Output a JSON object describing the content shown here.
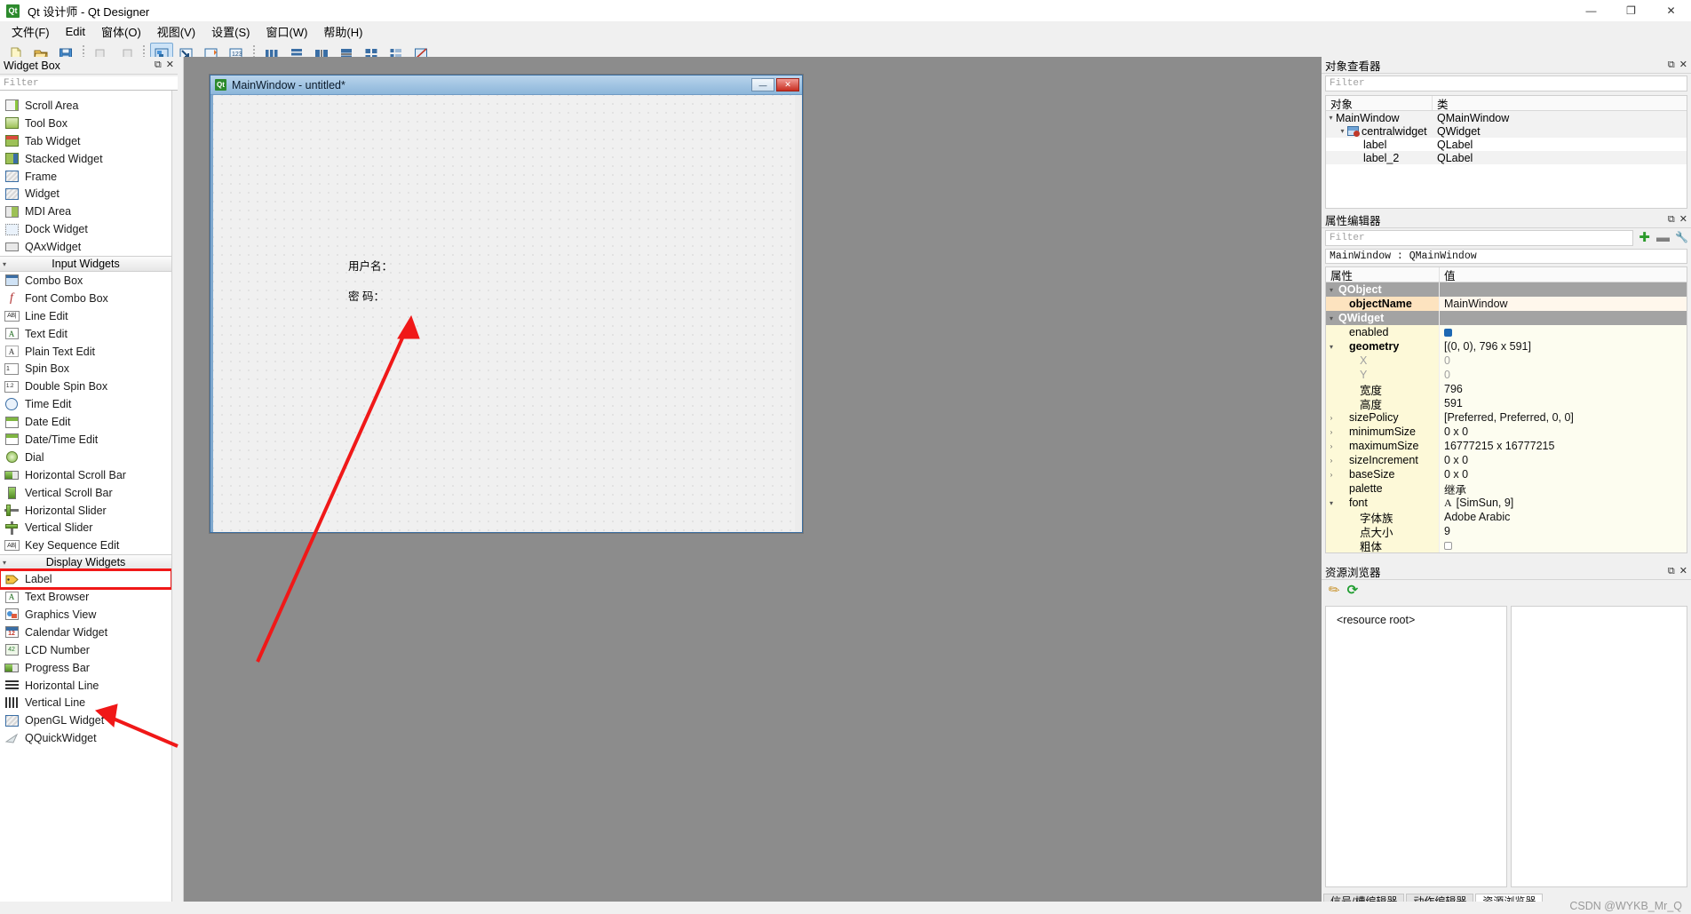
{
  "window": {
    "app_icon": "qt-logo-icon",
    "title": "Qt 设计师 - Qt Designer",
    "minimize": "—",
    "maximize": "❐",
    "close": "✕"
  },
  "menubar": {
    "items": [
      {
        "label": "文件(F)",
        "name": "menu-file"
      },
      {
        "label": "Edit",
        "name": "menu-edit"
      },
      {
        "label": "窗体(O)",
        "name": "menu-form"
      },
      {
        "label": "视图(V)",
        "name": "menu-view"
      },
      {
        "label": "设置(S)",
        "name": "menu-settings"
      },
      {
        "label": "窗口(W)",
        "name": "menu-window"
      },
      {
        "label": "帮助(H)",
        "name": "menu-help"
      }
    ]
  },
  "toolbar": {
    "buttons": [
      {
        "name": "new-form-button",
        "icon": "new-file-icon"
      },
      {
        "name": "open-form-button",
        "icon": "open-folder-icon"
      },
      {
        "name": "save-form-button",
        "icon": "save-disk-icon"
      },
      {
        "name": "undo-button",
        "icon": "undo-icon"
      },
      {
        "name": "redo-button",
        "icon": "redo-icon"
      },
      {
        "name": "edit-widgets-button",
        "icon": "edit-widgets-icon",
        "active": true
      },
      {
        "name": "edit-signals-slots-button",
        "icon": "signal-slot-icon"
      },
      {
        "name": "edit-buddies-button",
        "icon": "buddy-icon"
      },
      {
        "name": "edit-tab-order-button",
        "icon": "tab-order-icon"
      },
      {
        "name": "layout-horizontally-button",
        "icon": "layout-horizontal-icon"
      },
      {
        "name": "layout-vertically-button",
        "icon": "layout-vertical-icon"
      },
      {
        "name": "layout-splitter-h-button",
        "icon": "splitter-horizontal-icon"
      },
      {
        "name": "layout-splitter-v-button",
        "icon": "splitter-vertical-icon"
      },
      {
        "name": "layout-grid-button",
        "icon": "layout-grid-icon"
      },
      {
        "name": "layout-form-button",
        "icon": "layout-form-icon"
      },
      {
        "name": "break-layout-button",
        "icon": "break-layout-icon"
      }
    ]
  },
  "widget_box": {
    "title": "Widget Box",
    "float_icon": "float-dock-icon",
    "close_icon": "close-icon",
    "filter_placeholder": "Filter",
    "items": [
      {
        "label": "Scroll Area",
        "icon": "scroll-area-icon",
        "type": "item"
      },
      {
        "label": "Tool Box",
        "icon": "tool-box-icon",
        "type": "item"
      },
      {
        "label": "Tab Widget",
        "icon": "tab-widget-icon",
        "type": "item"
      },
      {
        "label": "Stacked Widget",
        "icon": "stacked-widget-icon",
        "type": "item"
      },
      {
        "label": "Frame",
        "icon": "frame-icon",
        "type": "item"
      },
      {
        "label": "Widget",
        "icon": "widget-icon",
        "type": "item"
      },
      {
        "label": "MDI Area",
        "icon": "mdi-area-icon",
        "type": "item"
      },
      {
        "label": "Dock Widget",
        "icon": "dock-widget-icon",
        "type": "item"
      },
      {
        "label": "QAxWidget",
        "icon": "qax-widget-icon",
        "type": "item"
      },
      {
        "label": "Input Widgets",
        "type": "category"
      },
      {
        "label": "Combo Box",
        "icon": "combo-box-icon",
        "type": "item"
      },
      {
        "label": "Font Combo Box",
        "icon": "font-combo-box-icon",
        "type": "item"
      },
      {
        "label": "Line Edit",
        "icon": "line-edit-icon",
        "type": "item"
      },
      {
        "label": "Text Edit",
        "icon": "text-edit-icon",
        "type": "item"
      },
      {
        "label": "Plain Text Edit",
        "icon": "plain-text-edit-icon",
        "type": "item"
      },
      {
        "label": "Spin Box",
        "icon": "spin-box-icon",
        "type": "item"
      },
      {
        "label": "Double Spin Box",
        "icon": "double-spin-box-icon",
        "type": "item"
      },
      {
        "label": "Time Edit",
        "icon": "time-edit-icon",
        "type": "item"
      },
      {
        "label": "Date Edit",
        "icon": "date-edit-icon",
        "type": "item"
      },
      {
        "label": "Date/Time Edit",
        "icon": "date-time-edit-icon",
        "type": "item"
      },
      {
        "label": "Dial",
        "icon": "dial-icon",
        "type": "item"
      },
      {
        "label": "Horizontal Scroll Bar",
        "icon": "horizontal-scroll-bar-icon",
        "type": "item"
      },
      {
        "label": "Vertical Scroll Bar",
        "icon": "vertical-scroll-bar-icon",
        "type": "item"
      },
      {
        "label": "Horizontal Slider",
        "icon": "horizontal-slider-icon",
        "type": "item"
      },
      {
        "label": "Vertical Slider",
        "icon": "vertical-slider-icon",
        "type": "item"
      },
      {
        "label": "Key Sequence Edit",
        "icon": "key-sequence-edit-icon",
        "type": "item"
      },
      {
        "label": "Display Widgets",
        "type": "category"
      },
      {
        "label": "Label",
        "icon": "label-icon",
        "type": "item",
        "highlighted": true
      },
      {
        "label": "Text Browser",
        "icon": "text-browser-icon",
        "type": "item"
      },
      {
        "label": "Graphics View",
        "icon": "graphics-view-icon",
        "type": "item"
      },
      {
        "label": "Calendar Widget",
        "icon": "calendar-widget-icon",
        "type": "item"
      },
      {
        "label": "LCD Number",
        "icon": "lcd-number-icon",
        "type": "item"
      },
      {
        "label": "Progress Bar",
        "icon": "progress-bar-icon",
        "type": "item"
      },
      {
        "label": "Horizontal Line",
        "icon": "horizontal-line-icon",
        "type": "item"
      },
      {
        "label": "Vertical Line",
        "icon": "vertical-line-icon",
        "type": "item"
      },
      {
        "label": "OpenGL Widget",
        "icon": "opengl-widget-icon",
        "type": "item"
      },
      {
        "label": "QQuickWidget",
        "icon": "qquick-widget-icon",
        "type": "item"
      }
    ]
  },
  "form": {
    "icon": "qt-logo-icon",
    "title": "MainWindow - untitled*",
    "minimize": "—",
    "close": "✕",
    "fields": [
      {
        "label": "用户名：",
        "name": "label-username"
      },
      {
        "label": "密  码：",
        "name": "label-password"
      }
    ]
  },
  "object_inspector": {
    "title": "对象查看器",
    "float_icon": "float-dock-icon",
    "close_icon": "close-icon",
    "filter_placeholder": "Filter",
    "columns": [
      "对象",
      "类"
    ],
    "rows": [
      {
        "object": "MainWindow",
        "class": "QMainWindow",
        "indent": 0,
        "twisty": "▾",
        "icon": ""
      },
      {
        "object": "centralwidget",
        "class": "QWidget",
        "indent": 1,
        "twisty": "▾",
        "icon": "central-widget-icon"
      },
      {
        "object": "label",
        "class": "QLabel",
        "indent": 2,
        "twisty": "",
        "icon": ""
      },
      {
        "object": "label_2",
        "class": "QLabel",
        "indent": 2,
        "twisty": "",
        "icon": ""
      }
    ]
  },
  "property_editor": {
    "title": "属性编辑器",
    "float_icon": "float-dock-icon",
    "close_icon": "close-icon",
    "filter_placeholder": "Filter",
    "add_icon": "plus-icon",
    "remove_icon": "minus-icon",
    "config_icon": "wrench-icon",
    "object_line": "MainWindow : QMainWindow",
    "columns": [
      "属性",
      "值"
    ],
    "rows": [
      {
        "name": "QObject",
        "value": "",
        "kind": "group",
        "twisty": "▾"
      },
      {
        "name": "objectName",
        "value": "MainWindow",
        "kind": "hot",
        "indent": 1
      },
      {
        "name": "QWidget",
        "value": "",
        "kind": "group",
        "twisty": "▾"
      },
      {
        "name": "enabled",
        "value": "",
        "kind": "check-on",
        "indent": 1
      },
      {
        "name": "geometry",
        "value": "[(0, 0), 796 x 591]",
        "kind": "bold",
        "twisty": "▾",
        "indent": 1
      },
      {
        "name": "X",
        "value": "0",
        "kind": "dim",
        "indent": 2
      },
      {
        "name": "Y",
        "value": "0",
        "kind": "dim",
        "indent": 2
      },
      {
        "name": "宽度",
        "value": "796",
        "kind": "normal",
        "indent": 2
      },
      {
        "name": "高度",
        "value": "591",
        "kind": "normal",
        "indent": 2
      },
      {
        "name": "sizePolicy",
        "value": "[Preferred, Preferred, 0, 0]",
        "kind": "normal",
        "twisty": "▸",
        "indent": 1
      },
      {
        "name": "minimumSize",
        "value": "0 x 0",
        "kind": "normal",
        "twisty": "▸",
        "indent": 1
      },
      {
        "name": "maximumSize",
        "value": "16777215 x 16777215",
        "kind": "normal",
        "twisty": "▸",
        "indent": 1
      },
      {
        "name": "sizeIncrement",
        "value": "0 x 0",
        "kind": "normal",
        "twisty": "▸",
        "indent": 1
      },
      {
        "name": "baseSize",
        "value": "0 x 0",
        "kind": "normal",
        "twisty": "▸",
        "indent": 1
      },
      {
        "name": "palette",
        "value": "继承",
        "kind": "normal",
        "indent": 1
      },
      {
        "name": "font",
        "value": "[SimSun, 9]",
        "kind": "normal",
        "twisty": "▾",
        "indent": 1,
        "value_icon": "font-A-icon"
      },
      {
        "name": "字体族",
        "value": "Adobe Arabic",
        "kind": "normal",
        "indent": 2
      },
      {
        "name": "点大小",
        "value": "9",
        "kind": "normal",
        "indent": 2
      },
      {
        "name": "粗体",
        "value": "",
        "kind": "check-off",
        "indent": 2
      }
    ]
  },
  "resource_browser": {
    "title": "资源浏览器",
    "float_icon": "float-dock-icon",
    "close_icon": "close-icon",
    "edit_icon": "pencil-icon",
    "reload_icon": "refresh-icon",
    "root_label": "<resource root>",
    "tabs": [
      {
        "label": "信号/槽编辑器",
        "name": "tab-signal-slot-editor",
        "active": false
      },
      {
        "label": "动作编辑器",
        "name": "tab-action-editor",
        "active": false
      },
      {
        "label": "资源浏览器",
        "name": "tab-resource-browser",
        "active": true
      }
    ]
  },
  "watermark": "CSDN @WYKB_Mr_Q",
  "colors": {
    "accent": "#3c6ea0",
    "annotation": "#f01818",
    "property_highlight": "#fde3bf",
    "group_row": "#a3a3a3"
  }
}
